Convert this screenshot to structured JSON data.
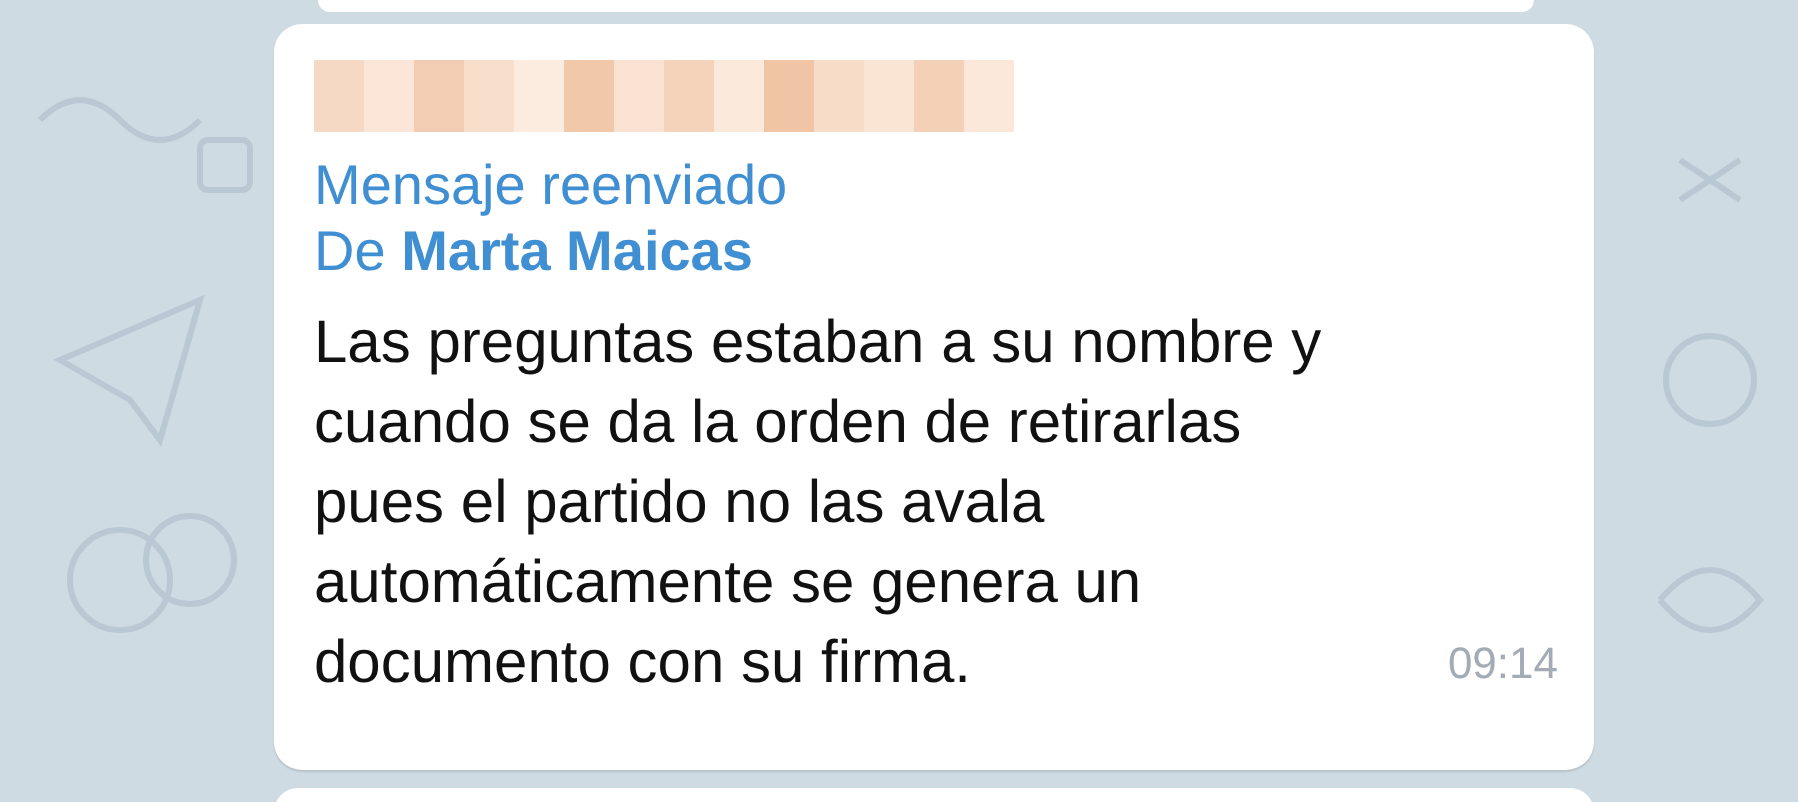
{
  "message": {
    "forwarded_label": "Mensaje reenviado",
    "forwarded_from": "De **Marta Maicas**",
    "text": "Las preguntas estaban a su nombre y\ncuando se da la orden de retirarlas\npues el partido no las avala\nautomáticamente se genera un\ndocumento con su firma.",
    "time": "09:14"
  }
}
